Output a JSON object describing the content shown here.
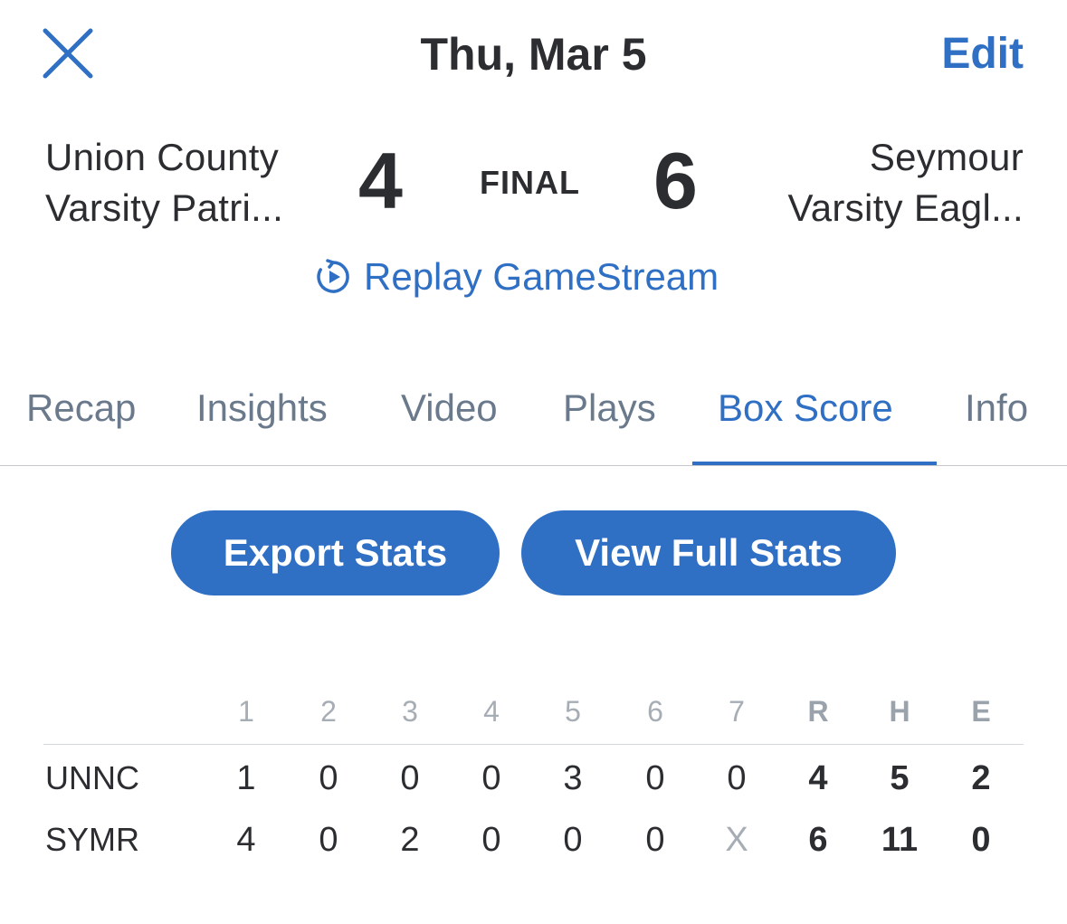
{
  "header": {
    "date": "Thu, Mar 5",
    "edit_label": "Edit"
  },
  "game": {
    "home_team_line1": "Union County",
    "home_team_line2": "Varsity Patri...",
    "home_score": "4",
    "status": "FINAL",
    "away_score": "6",
    "away_team_line1": "Seymour",
    "away_team_line2": "Varsity Eagl...",
    "replay_label": "Replay GameStream"
  },
  "tabs": [
    {
      "label": "Recap"
    },
    {
      "label": "Insights"
    },
    {
      "label": "Video"
    },
    {
      "label": "Plays"
    },
    {
      "label": "Box Score"
    },
    {
      "label": "Info"
    }
  ],
  "active_tab": "Box Score",
  "actions": {
    "export_label": "Export Stats",
    "full_label": "View Full Stats"
  },
  "box_score": {
    "headers": [
      "1",
      "2",
      "3",
      "4",
      "5",
      "6",
      "7",
      "R",
      "H",
      "E"
    ],
    "rows": [
      {
        "team": "UNNC",
        "values": [
          "1",
          "0",
          "0",
          "0",
          "3",
          "0",
          "0",
          "4",
          "5",
          "2"
        ]
      },
      {
        "team": "SYMR",
        "values": [
          "4",
          "0",
          "2",
          "0",
          "0",
          "0",
          "X",
          "6",
          "11",
          "0"
        ]
      }
    ]
  },
  "colors": {
    "accent": "#2f6fc4",
    "text": "#2b2d31",
    "muted": "#6a7a8c",
    "header_muted": "#a7adb5"
  },
  "icons": {
    "close": "close-icon",
    "replay": "replay-icon"
  }
}
